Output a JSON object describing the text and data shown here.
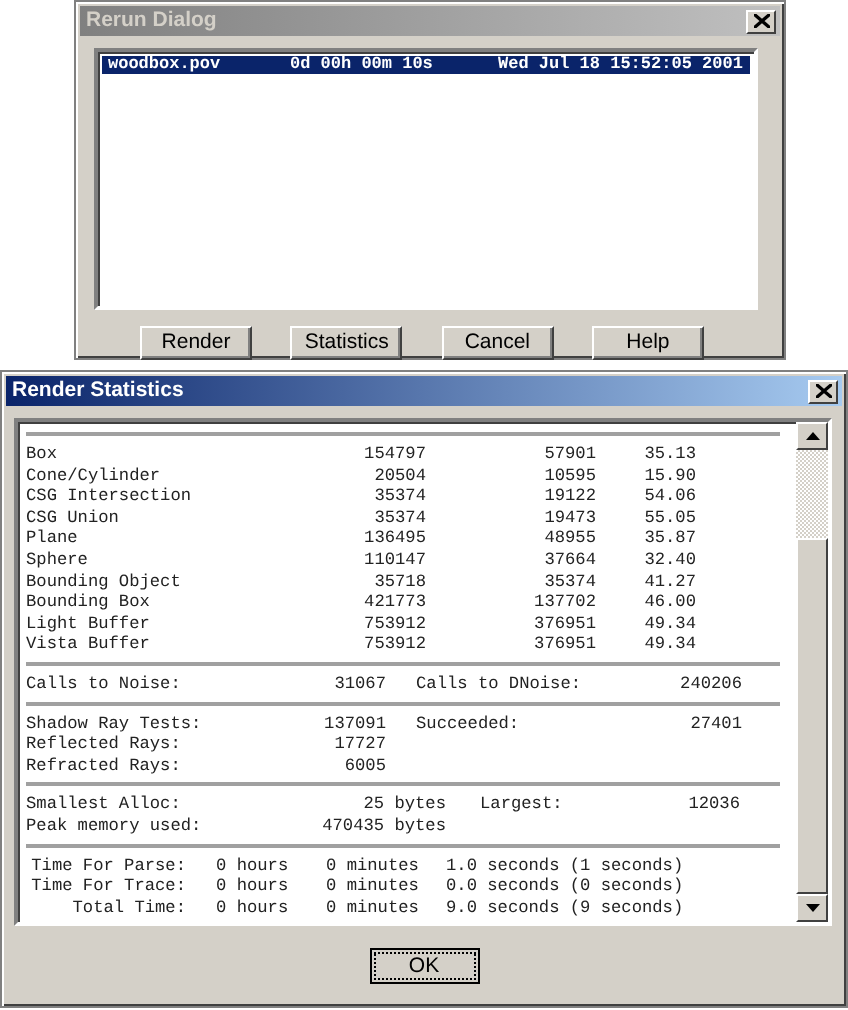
{
  "rerun_dialog": {
    "title": "Rerun Dialog",
    "active": false,
    "rows": [
      {
        "file": "woodbox.pov",
        "time": "0d 00h 00m 10s",
        "date": "Wed Jul 18 15:52:05 2001",
        "selected": true
      }
    ],
    "buttons": [
      "Render",
      "Statistics",
      "Cancel",
      "Help"
    ]
  },
  "render_statistics": {
    "title": "Render Statistics",
    "active": true,
    "sections": [
      {
        "kind": "objects",
        "rows": [
          [
            "Box",
            "154797",
            "57901",
            "35.13"
          ],
          [
            "Cone/Cylinder",
            "20504",
            "10595",
            "15.90"
          ],
          [
            "CSG Intersection",
            "35374",
            "19122",
            "54.06"
          ],
          [
            "CSG Union",
            "35374",
            "19473",
            "55.05"
          ],
          [
            "Plane",
            "136495",
            "48955",
            "35.87"
          ],
          [
            "Sphere",
            "110147",
            "37664",
            "32.40"
          ],
          [
            "Bounding Object",
            "35718",
            "35374",
            "41.27"
          ],
          [
            "Bounding Box",
            "421773",
            "137702",
            "46.00"
          ],
          [
            "Light Buffer",
            "753912",
            "376951",
            "49.34"
          ],
          [
            "Vista Buffer",
            "753912",
            "376951",
            "49.34"
          ]
        ]
      },
      {
        "kind": "pairs",
        "rows": [
          [
            "Calls to Noise:",
            "31067",
            "Calls to DNoise:",
            "240206"
          ]
        ]
      },
      {
        "kind": "pairs",
        "rows": [
          [
            "Shadow Ray Tests:",
            "137091",
            "Succeeded:",
            "27401"
          ],
          [
            "Reflected Rays:",
            "17727"
          ],
          [
            "Refracted Rays:",
            "6005"
          ]
        ]
      },
      {
        "kind": "memory",
        "rows": [
          [
            "Smallest Alloc:",
            "25 bytes",
            "Largest:",
            "12036"
          ],
          [
            "Peak memory used:",
            "470435 bytes"
          ]
        ]
      },
      {
        "kind": "times",
        "rows": [
          [
            "Time For Parse:",
            "0 hours",
            "0 minutes",
            "1.0 seconds (1 seconds)"
          ],
          [
            "Time For Trace:",
            "0 hours",
            "0 minutes",
            "0.0 seconds (0 seconds)"
          ],
          [
            "Total Time:",
            "0 hours",
            "0 minutes",
            "9.0 seconds (9 seconds)"
          ]
        ]
      }
    ],
    "ok_button": "OK"
  }
}
